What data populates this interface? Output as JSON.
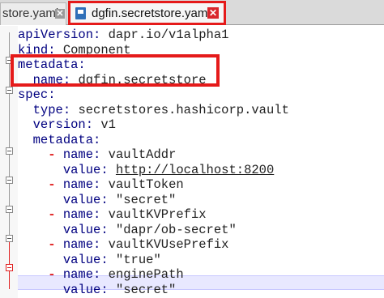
{
  "tabs": {
    "inactive": {
      "label": "store.yaml"
    },
    "active": {
      "label": "dgfin.secretstore.yaml"
    }
  },
  "lines": [
    {
      "indent": "",
      "key": "apiVersion",
      "sep": ": ",
      "value": "dapr.io/v1alpha1"
    },
    {
      "indent": "",
      "key": "kind",
      "sep": ": ",
      "value": "Component"
    },
    {
      "indent": "",
      "key": "metadata",
      "sep": ":",
      "value": ""
    },
    {
      "indent": "  ",
      "key": "name",
      "sep": ": ",
      "value": "dgfin.secretstore"
    },
    {
      "indent": "",
      "key": "spec",
      "sep": ":",
      "value": ""
    },
    {
      "indent": "  ",
      "key": "type",
      "sep": ": ",
      "value": "secretstores.hashicorp.vault"
    },
    {
      "indent": "  ",
      "key": "version",
      "sep": ": ",
      "value": "v1"
    },
    {
      "indent": "  ",
      "key": "metadata",
      "sep": ":",
      "value": ""
    },
    {
      "indent": "    ",
      "dash": "- ",
      "key": "name",
      "sep": ": ",
      "value": "vaultAddr"
    },
    {
      "indent": "      ",
      "key": "value",
      "sep": ": ",
      "value": "http://localhost:8200",
      "link": true
    },
    {
      "indent": "    ",
      "dash": "- ",
      "key": "name",
      "sep": ": ",
      "value": "vaultToken"
    },
    {
      "indent": "      ",
      "key": "value",
      "sep": ": ",
      "value": "\"secret\""
    },
    {
      "indent": "    ",
      "dash": "- ",
      "key": "name",
      "sep": ": ",
      "value": "vaultKVPrefix"
    },
    {
      "indent": "      ",
      "key": "value",
      "sep": ": ",
      "value": "\"dapr/ob-secret\""
    },
    {
      "indent": "    ",
      "dash": "- ",
      "key": "name",
      "sep": ": ",
      "value": "vaultKVUsePrefix"
    },
    {
      "indent": "      ",
      "key": "value",
      "sep": ": ",
      "value": "\"true\""
    },
    {
      "indent": "    ",
      "dash": "- ",
      "key": "name",
      "sep": ": ",
      "value": "enginePath"
    },
    {
      "indent": "      ",
      "key": "value",
      "sep": ": ",
      "value": "\"secret\""
    }
  ],
  "colors": {
    "highlight": "#e51a1a",
    "key": "#000080",
    "dash": "#e02020",
    "current_line": "#e8e8ff"
  }
}
